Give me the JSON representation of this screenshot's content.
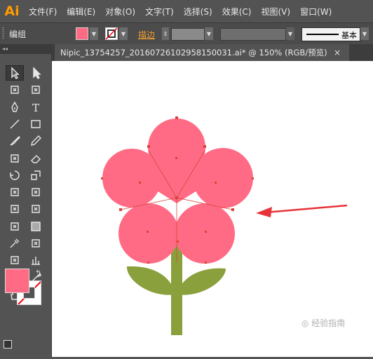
{
  "app": {
    "logo": "Ai",
    "menu": [
      "文件(F)",
      "编辑(E)",
      "对象(O)",
      "文字(T)",
      "选择(S)",
      "效果(C)",
      "视图(V)",
      "窗口(W)"
    ]
  },
  "control_bar": {
    "selection_label": "编组",
    "stroke_label": "描边",
    "brush_label": "基本",
    "fill_color": "#ff6b85"
  },
  "document": {
    "tab_title": "Nipic_13754257_20160726102958150031.ai* @ 150% (RGB/预览)",
    "close_glyph": "×"
  },
  "toolbox": {
    "fill_color": "#ff6b85",
    "tools": [
      "selection-tool",
      "direct-selection-tool",
      "magic-wand-tool",
      "lasso-tool",
      "pen-tool",
      "type-tool",
      "line-tool",
      "rectangle-tool",
      "paintbrush-tool",
      "pencil-tool",
      "blob-brush-tool",
      "eraser-tool",
      "rotate-tool",
      "scale-tool",
      "warp-tool",
      "free-transform-tool",
      "shape-builder-tool",
      "perspective-grid-tool",
      "mesh-tool",
      "gradient-tool",
      "eyedropper-tool",
      "blend-tool",
      "symbol-sprayer-tool",
      "column-graph-tool",
      "artboard-tool",
      "slice-tool",
      "hand-tool",
      "zoom-tool"
    ]
  },
  "artwork": {
    "petal_color": "#ff6b85",
    "stem_color": "#8aa03c",
    "arrow_color": "#e8333a"
  },
  "watermark": "◎ 经验指南"
}
